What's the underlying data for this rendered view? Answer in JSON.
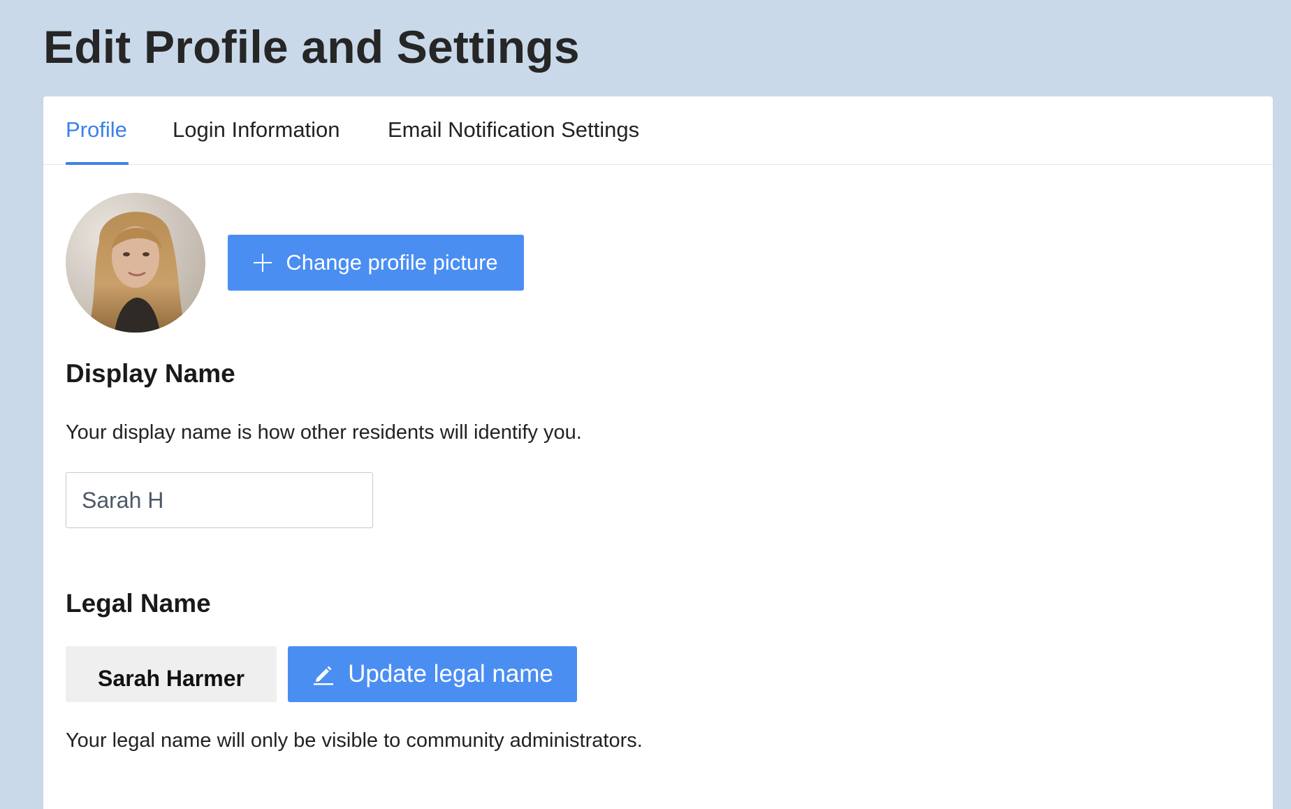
{
  "page": {
    "title": "Edit Profile and Settings"
  },
  "tabs": [
    {
      "label": "Profile",
      "active": true
    },
    {
      "label": "Login Information",
      "active": false
    },
    {
      "label": "Email Notification Settings",
      "active": false
    }
  ],
  "profile_picture": {
    "change_button_label": "Change profile picture",
    "button_icon": "plus-icon"
  },
  "display_name": {
    "heading": "Display Name",
    "help_text": "Your display name is how other residents will identify you.",
    "value": "Sarah H"
  },
  "legal_name": {
    "heading": "Legal Name",
    "value": "Sarah Harmer",
    "update_button_label": "Update legal name",
    "button_icon": "pencil-icon",
    "help_text": "Your legal name will only be visible to community administrators."
  },
  "colors": {
    "background": "#c9d9e9",
    "accent": "#4a8ef2",
    "active_tab": "#3b82e8",
    "card": "#ffffff"
  }
}
